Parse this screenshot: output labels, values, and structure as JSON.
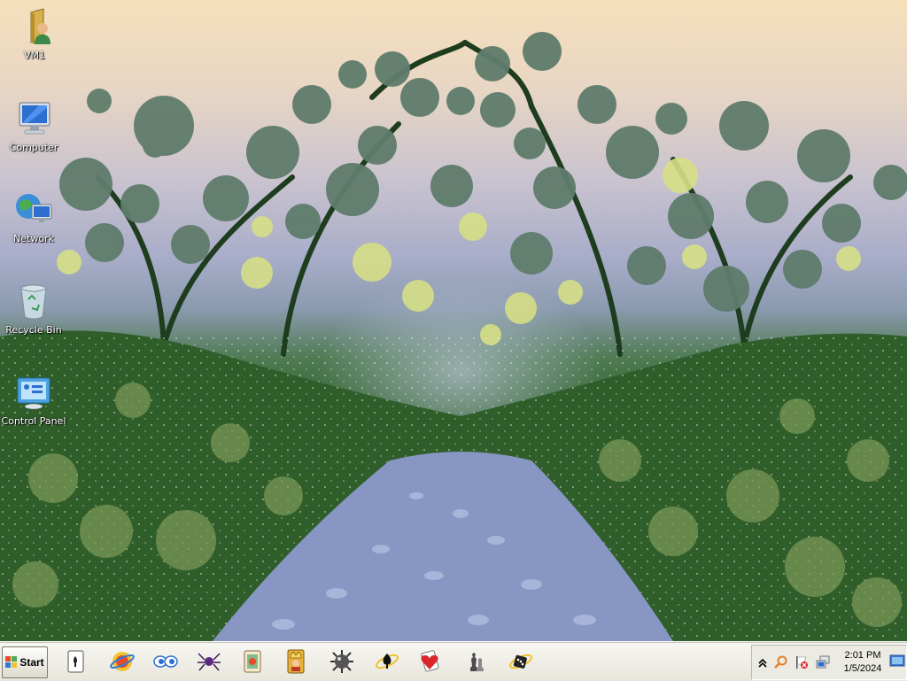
{
  "desktop": {
    "icons": [
      {
        "label": "VM1",
        "icon": "user-folder-icon"
      },
      {
        "label": "Computer",
        "icon": "computer-icon"
      },
      {
        "label": "Network",
        "icon": "network-icon"
      },
      {
        "label": "Recycle Bin",
        "icon": "recycle-bin-icon"
      },
      {
        "label": "Control Panel",
        "icon": "control-panel-icon"
      }
    ]
  },
  "taskbar": {
    "start_label": "Start",
    "quick_launch": [
      "solitaire-icon",
      "internet-games-icon",
      "purble-place-icon",
      "spider-solitaire-icon",
      "mahjong-icon",
      "freecell-icon",
      "minesweeper-icon",
      "internet-spades-icon",
      "hearts-icon",
      "chess-icon",
      "internet-backgammon-icon"
    ]
  },
  "tray": {
    "icons": [
      "show-hidden-chevron-icon",
      "search-icon",
      "action-center-flag-icon",
      "network-tray-icon"
    ],
    "time": "2:01 PM",
    "date": "1/5/2024"
  },
  "colors": {
    "sky_top": "#f6e0bc",
    "foliage": "#2f5e2a",
    "path": "#8796c2",
    "taskbar": "#ece9df"
  }
}
